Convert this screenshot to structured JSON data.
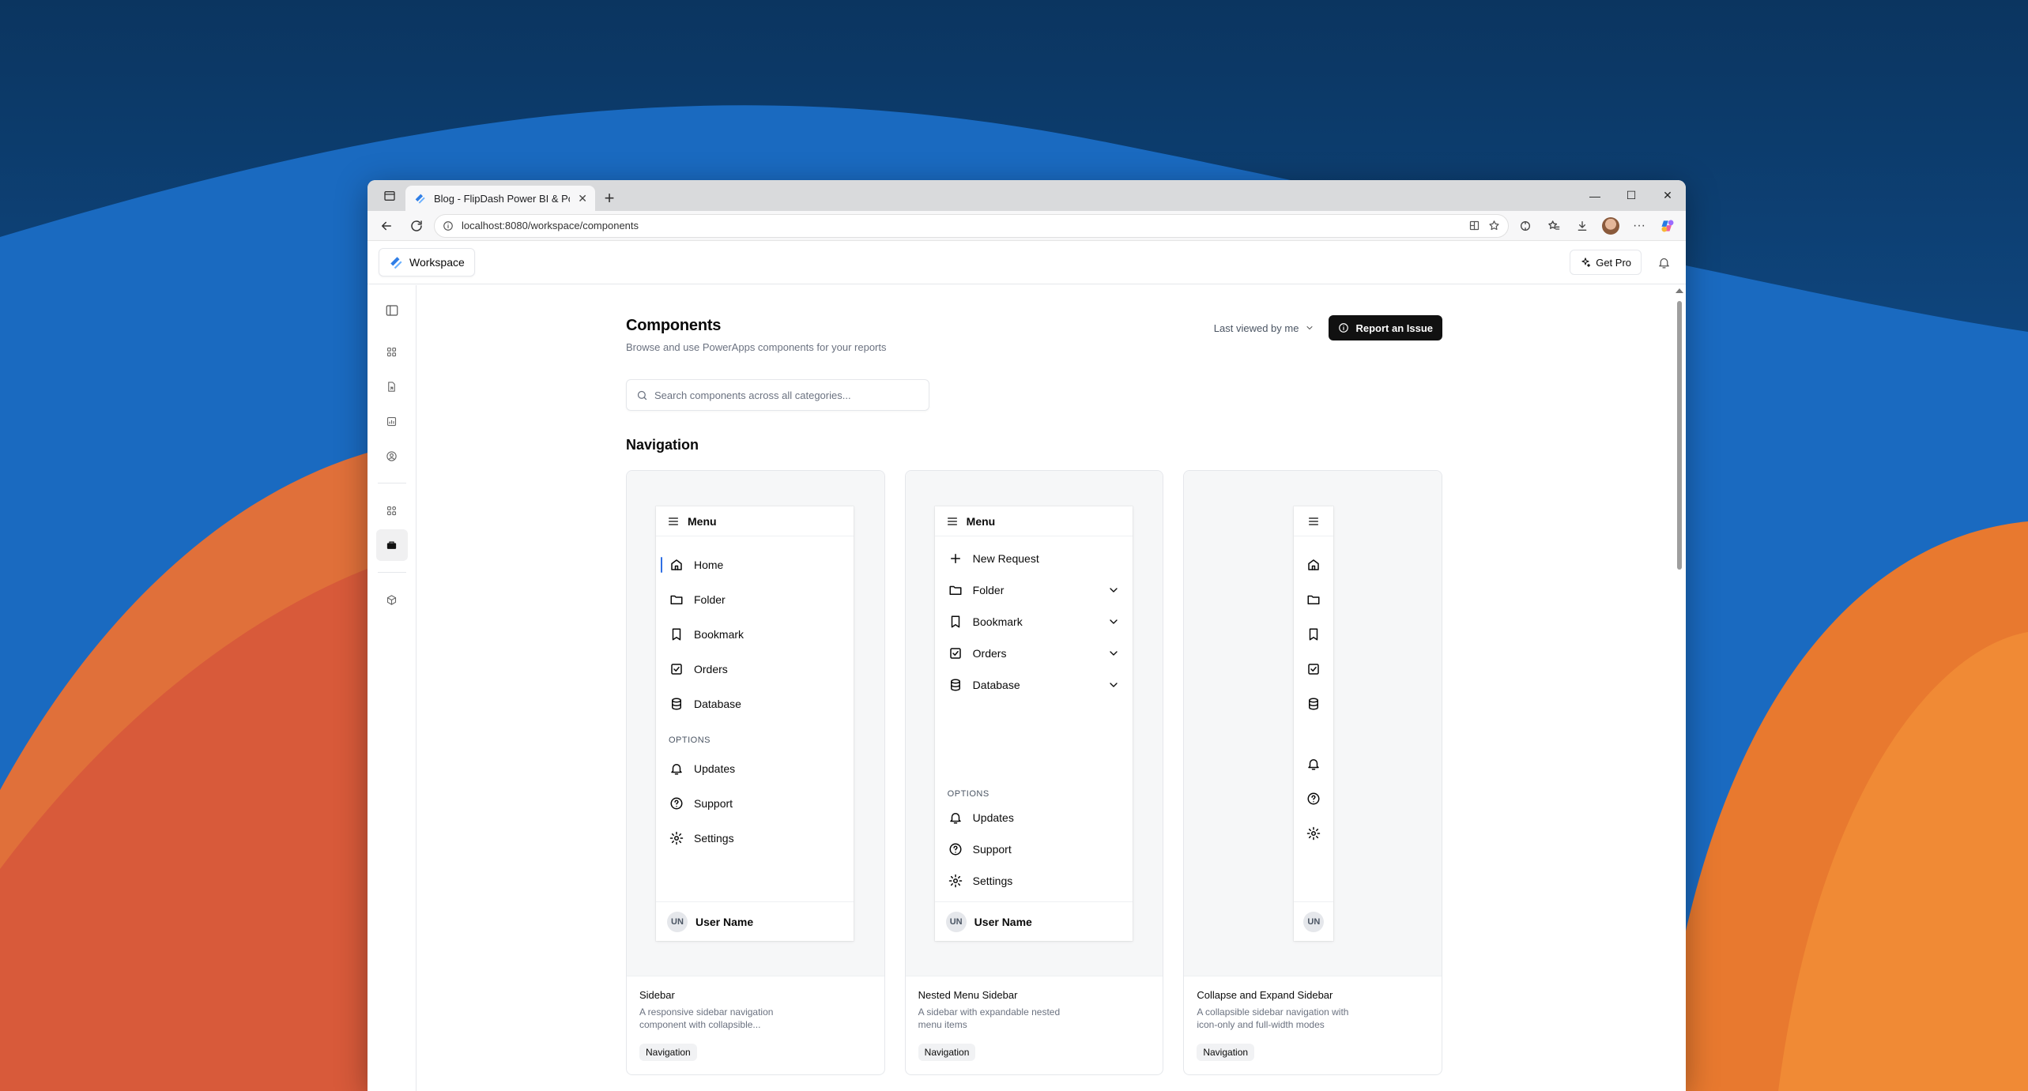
{
  "browser": {
    "tab_title": "Blog - FlipDash Power BI & Power",
    "url": "localhost:8080/workspace/components"
  },
  "app": {
    "workspace_label": "Workspace",
    "get_pro_label": "Get Pro"
  },
  "page": {
    "title": "Components",
    "subtitle": "Browse and use PowerApps components for your reports",
    "sort_label": "Last viewed by me",
    "report_button": "Report an Issue",
    "search_placeholder": "Search components across all categories...",
    "section_title": "Navigation"
  },
  "cards": [
    {
      "name": "Sidebar",
      "description": "A responsive sidebar navigation component with collapsible...",
      "tag": "Navigation",
      "preview": {
        "header": "Menu",
        "items": [
          "Home",
          "Folder",
          "Bookmark",
          "Orders",
          "Database"
        ],
        "section": "OPTIONS",
        "options": [
          "Updates",
          "Support",
          "Settings"
        ],
        "user_initials": "UN",
        "user_name": "User Name"
      }
    },
    {
      "name": "Nested Menu Sidebar",
      "description": "A sidebar with expandable nested menu items",
      "tag": "Navigation",
      "preview": {
        "header": "Menu",
        "action": "New Request",
        "items": [
          "Folder",
          "Bookmark",
          "Orders",
          "Database"
        ],
        "section": "OPTIONS",
        "options": [
          "Updates",
          "Support",
          "Settings"
        ],
        "user_initials": "UN",
        "user_name": "User Name"
      }
    },
    {
      "name": "Collapse and Expand Sidebar",
      "description": "A collapsible sidebar navigation with icon-only and full-width modes",
      "tag": "Navigation",
      "preview": {
        "user_initials": "UN"
      }
    }
  ]
}
